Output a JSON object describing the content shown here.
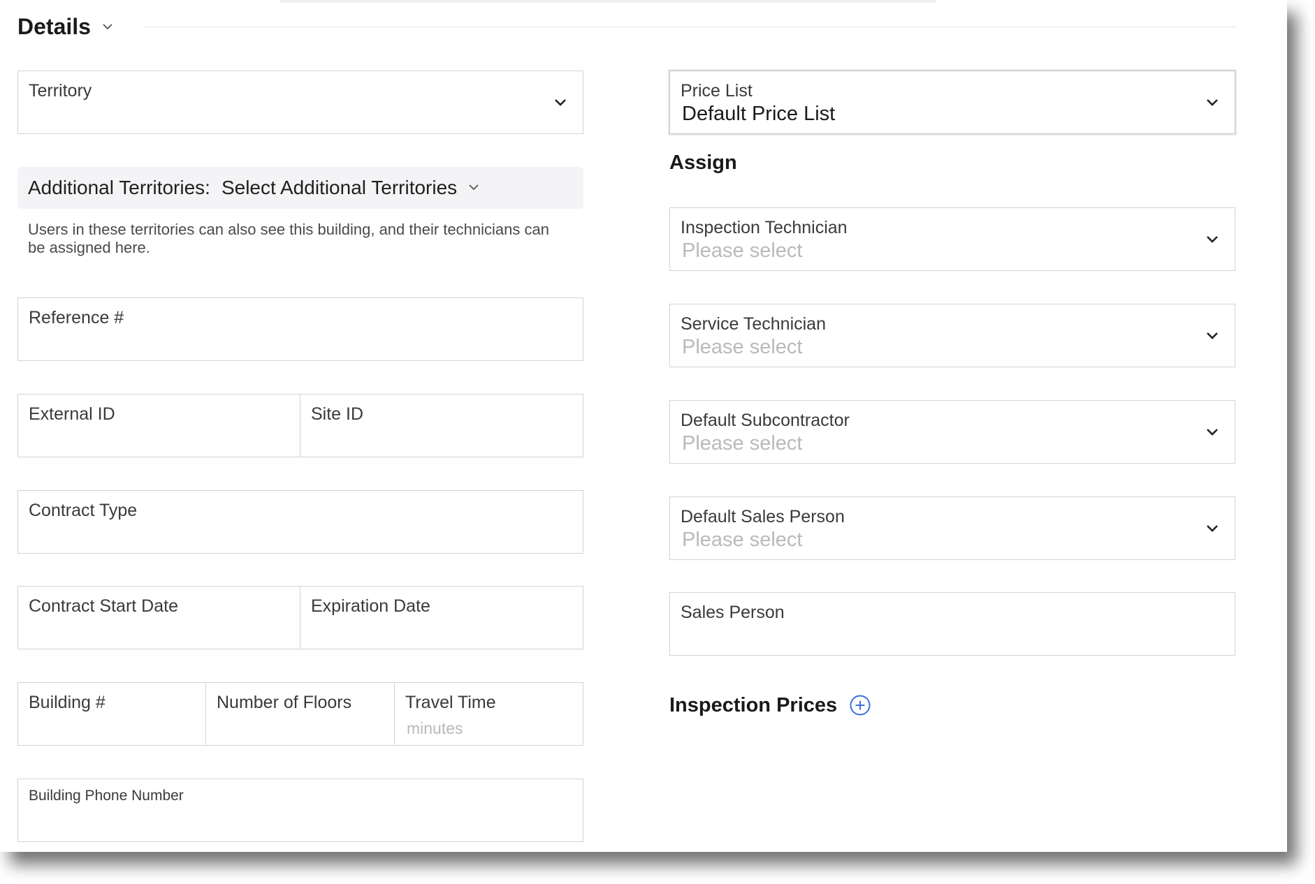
{
  "section": {
    "title": "Details"
  },
  "left": {
    "territory": {
      "label": "Territory"
    },
    "additional_territories": {
      "label": "Additional Territories:",
      "select_text": "Select Additional Territories",
      "help_text": "Users in these territories can also see this building, and their technicians can be assigned here."
    },
    "reference": {
      "label": "Reference #"
    },
    "external_id": {
      "label": "External ID"
    },
    "site_id": {
      "label": "Site ID"
    },
    "contract_type": {
      "label": "Contract Type"
    },
    "contract_start": {
      "label": "Contract Start Date"
    },
    "expiration": {
      "label": "Expiration Date"
    },
    "building_number": {
      "label": "Building #"
    },
    "floors": {
      "label": "Number of Floors"
    },
    "travel_time": {
      "label": "Travel Time",
      "hint": "minutes"
    },
    "phone": {
      "label": "Building Phone Number"
    }
  },
  "right": {
    "price_list": {
      "label": "Price List",
      "value": "Default Price List"
    },
    "assign_heading": "Assign",
    "inspection_technician": {
      "label": "Inspection Technician",
      "placeholder": "Please select"
    },
    "service_technician": {
      "label": "Service Technician",
      "placeholder": "Please select"
    },
    "default_subcontractor": {
      "label": "Default Subcontractor",
      "placeholder": "Please select"
    },
    "default_sales_person": {
      "label": "Default Sales Person",
      "placeholder": "Please select"
    },
    "sales_person": {
      "label": "Sales Person"
    },
    "inspection_prices_heading": "Inspection Prices"
  },
  "icons": {
    "chevron": "chevron-down-icon",
    "add": "plus-circle-icon"
  },
  "colors": {
    "accent": "#3f6fd8",
    "border": "#d3d3d8",
    "placeholder": "#b9b9be"
  }
}
